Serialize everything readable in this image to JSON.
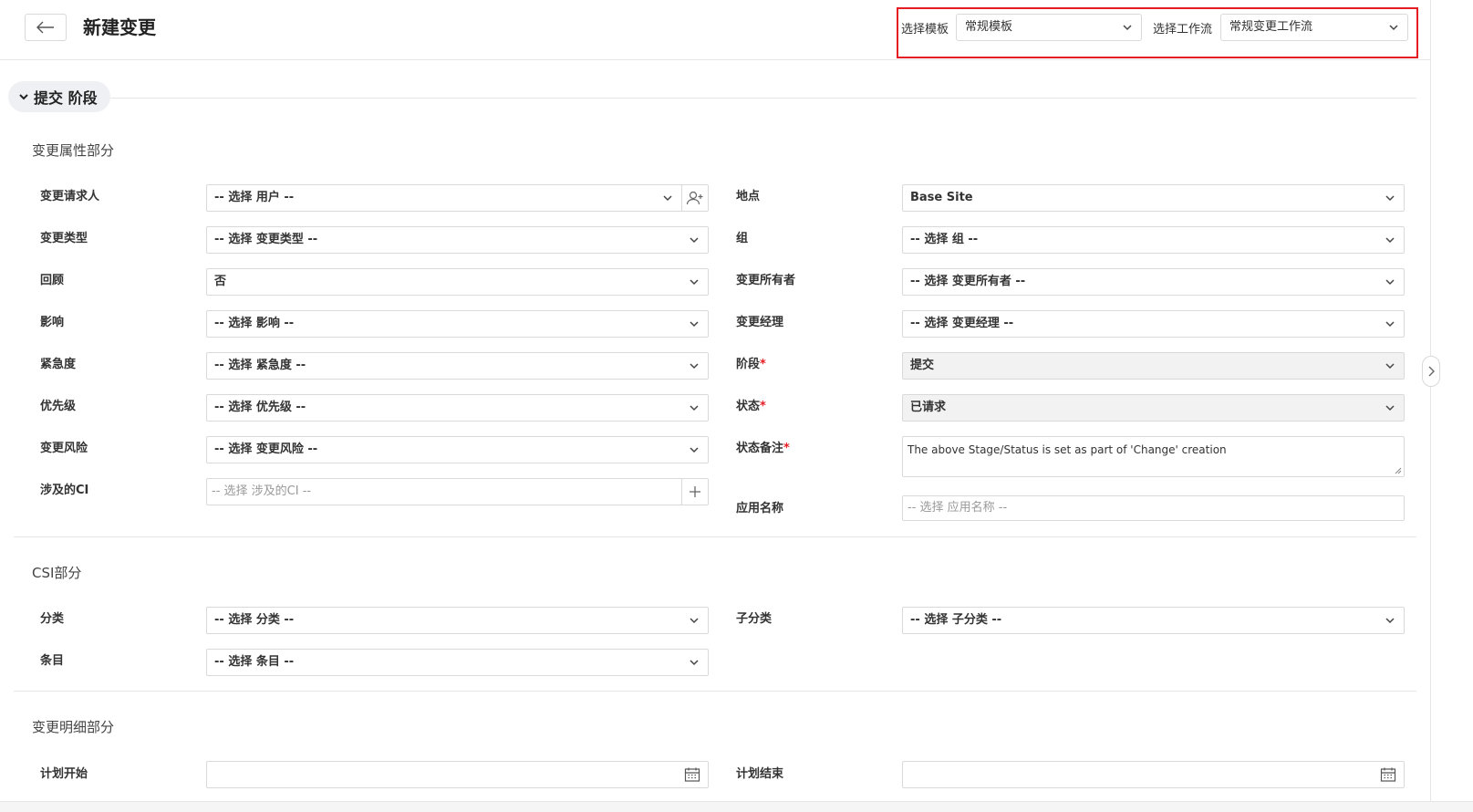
{
  "header": {
    "title": "新建变更",
    "template_label": "选择模板",
    "template_value": "常规模板",
    "workflow_label": "选择工作流",
    "workflow_value": "常规变更工作流"
  },
  "stage": {
    "label": "提交 阶段"
  },
  "sections": {
    "attributes": "变更属性部分",
    "csi": "CSI部分",
    "details": "变更明细部分"
  },
  "fields": {
    "requester": {
      "label": "变更请求人",
      "value": "-- 选择 用户 --"
    },
    "change_type": {
      "label": "变更类型",
      "value": "-- 选择 变更类型 --"
    },
    "review": {
      "label": "回顾",
      "value": "否"
    },
    "impact": {
      "label": "影响",
      "value": "-- 选择 影响 --"
    },
    "urgency": {
      "label": "紧急度",
      "value": "-- 选择 紧急度 --"
    },
    "priority": {
      "label": "优先级",
      "value": "-- 选择 优先级 --"
    },
    "risk": {
      "label": "变更风险",
      "value": "-- 选择 变更风险 --"
    },
    "ci": {
      "label": "涉及的CI",
      "placeholder": "-- 选择 涉及的CI --"
    },
    "site": {
      "label": "地点",
      "value": "Base Site"
    },
    "group": {
      "label": "组",
      "value": "-- 选择 组 --"
    },
    "owner": {
      "label": "变更所有者",
      "value": "-- 选择 变更所有者 --"
    },
    "manager": {
      "label": "变更经理",
      "value": "-- 选择 变更经理 --"
    },
    "stage": {
      "label": "阶段",
      "value": "提交"
    },
    "status": {
      "label": "状态",
      "value": "已请求"
    },
    "status_comment": {
      "label": "状态备注",
      "value": "The above Stage/Status is set as part of 'Change' creation"
    },
    "app_name": {
      "label": "应用名称",
      "placeholder": "-- 选择 应用名称 --"
    },
    "category": {
      "label": "分类",
      "value": "-- 选择 分类 --"
    },
    "subcategory": {
      "label": "子分类",
      "value": "-- 选择 子分类 --"
    },
    "item": {
      "label": "条目",
      "value": "-- 选择 条目 --"
    },
    "planned_start": {
      "label": "计划开始",
      "value": ""
    },
    "planned_end": {
      "label": "计划结束",
      "value": ""
    }
  },
  "required_mark": "*",
  "colors": {
    "required": "#e51c23",
    "highlight_border": "#e51c23"
  }
}
